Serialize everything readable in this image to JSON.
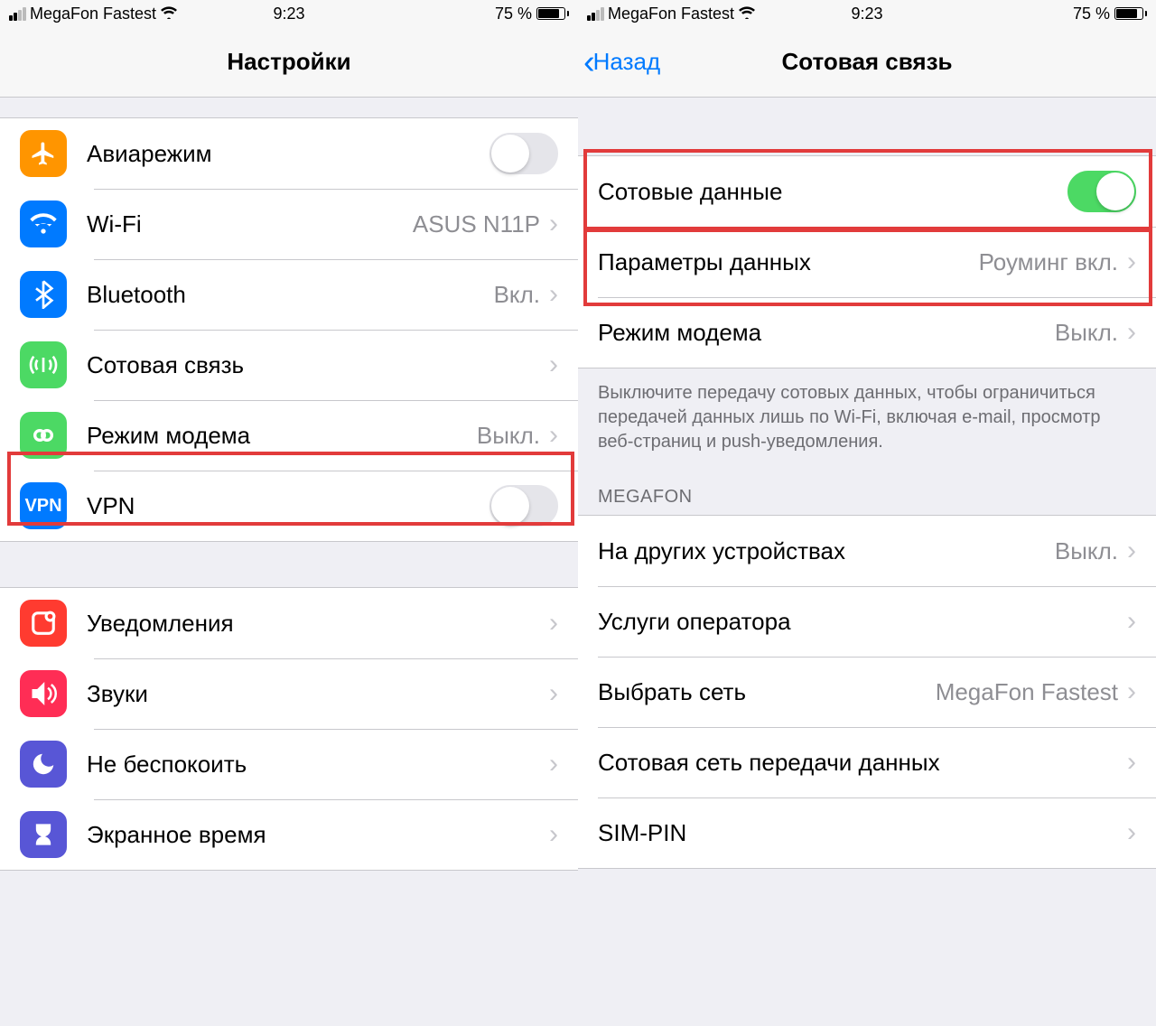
{
  "status": {
    "carrier": "MegaFon Fastest",
    "time": "9:23",
    "battery_pct": "75 %"
  },
  "left": {
    "title": "Настройки",
    "rows": {
      "airplane": "Авиарежим",
      "wifi": "Wi-Fi",
      "wifi_val": "ASUS N11P",
      "bt": "Bluetooth",
      "bt_val": "Вкл.",
      "cell": "Сотовая связь",
      "hotspot": "Режим модема",
      "hotspot_val": "Выкл.",
      "vpn": "VPN",
      "vpn_icon": "VPN",
      "notif": "Уведомления",
      "sound": "Звуки",
      "dnd": "Не беспокоить",
      "screen": "Экранное время"
    }
  },
  "right": {
    "back": "Назад",
    "title": "Сотовая связь",
    "rows": {
      "data": "Сотовые данные",
      "params": "Параметры данных",
      "params_val": "Роуминг вкл.",
      "hotspot": "Режим модема",
      "hotspot_val": "Выкл.",
      "other_dev": "На других устройствах",
      "other_dev_val": "Выкл.",
      "services": "Услуги оператора",
      "select_net": "Выбрать сеть",
      "select_net_val": "MegaFon Fastest",
      "apn": "Сотовая сеть передачи данных",
      "simpin": "SIM-PIN"
    },
    "footer1": "Выключите передачу сотовых данных, чтобы ограничиться передачей данных лишь по Wi-Fi, включая e-mail, просмотр веб-страниц и push-уведомления.",
    "section_header": "MEGAFON"
  }
}
